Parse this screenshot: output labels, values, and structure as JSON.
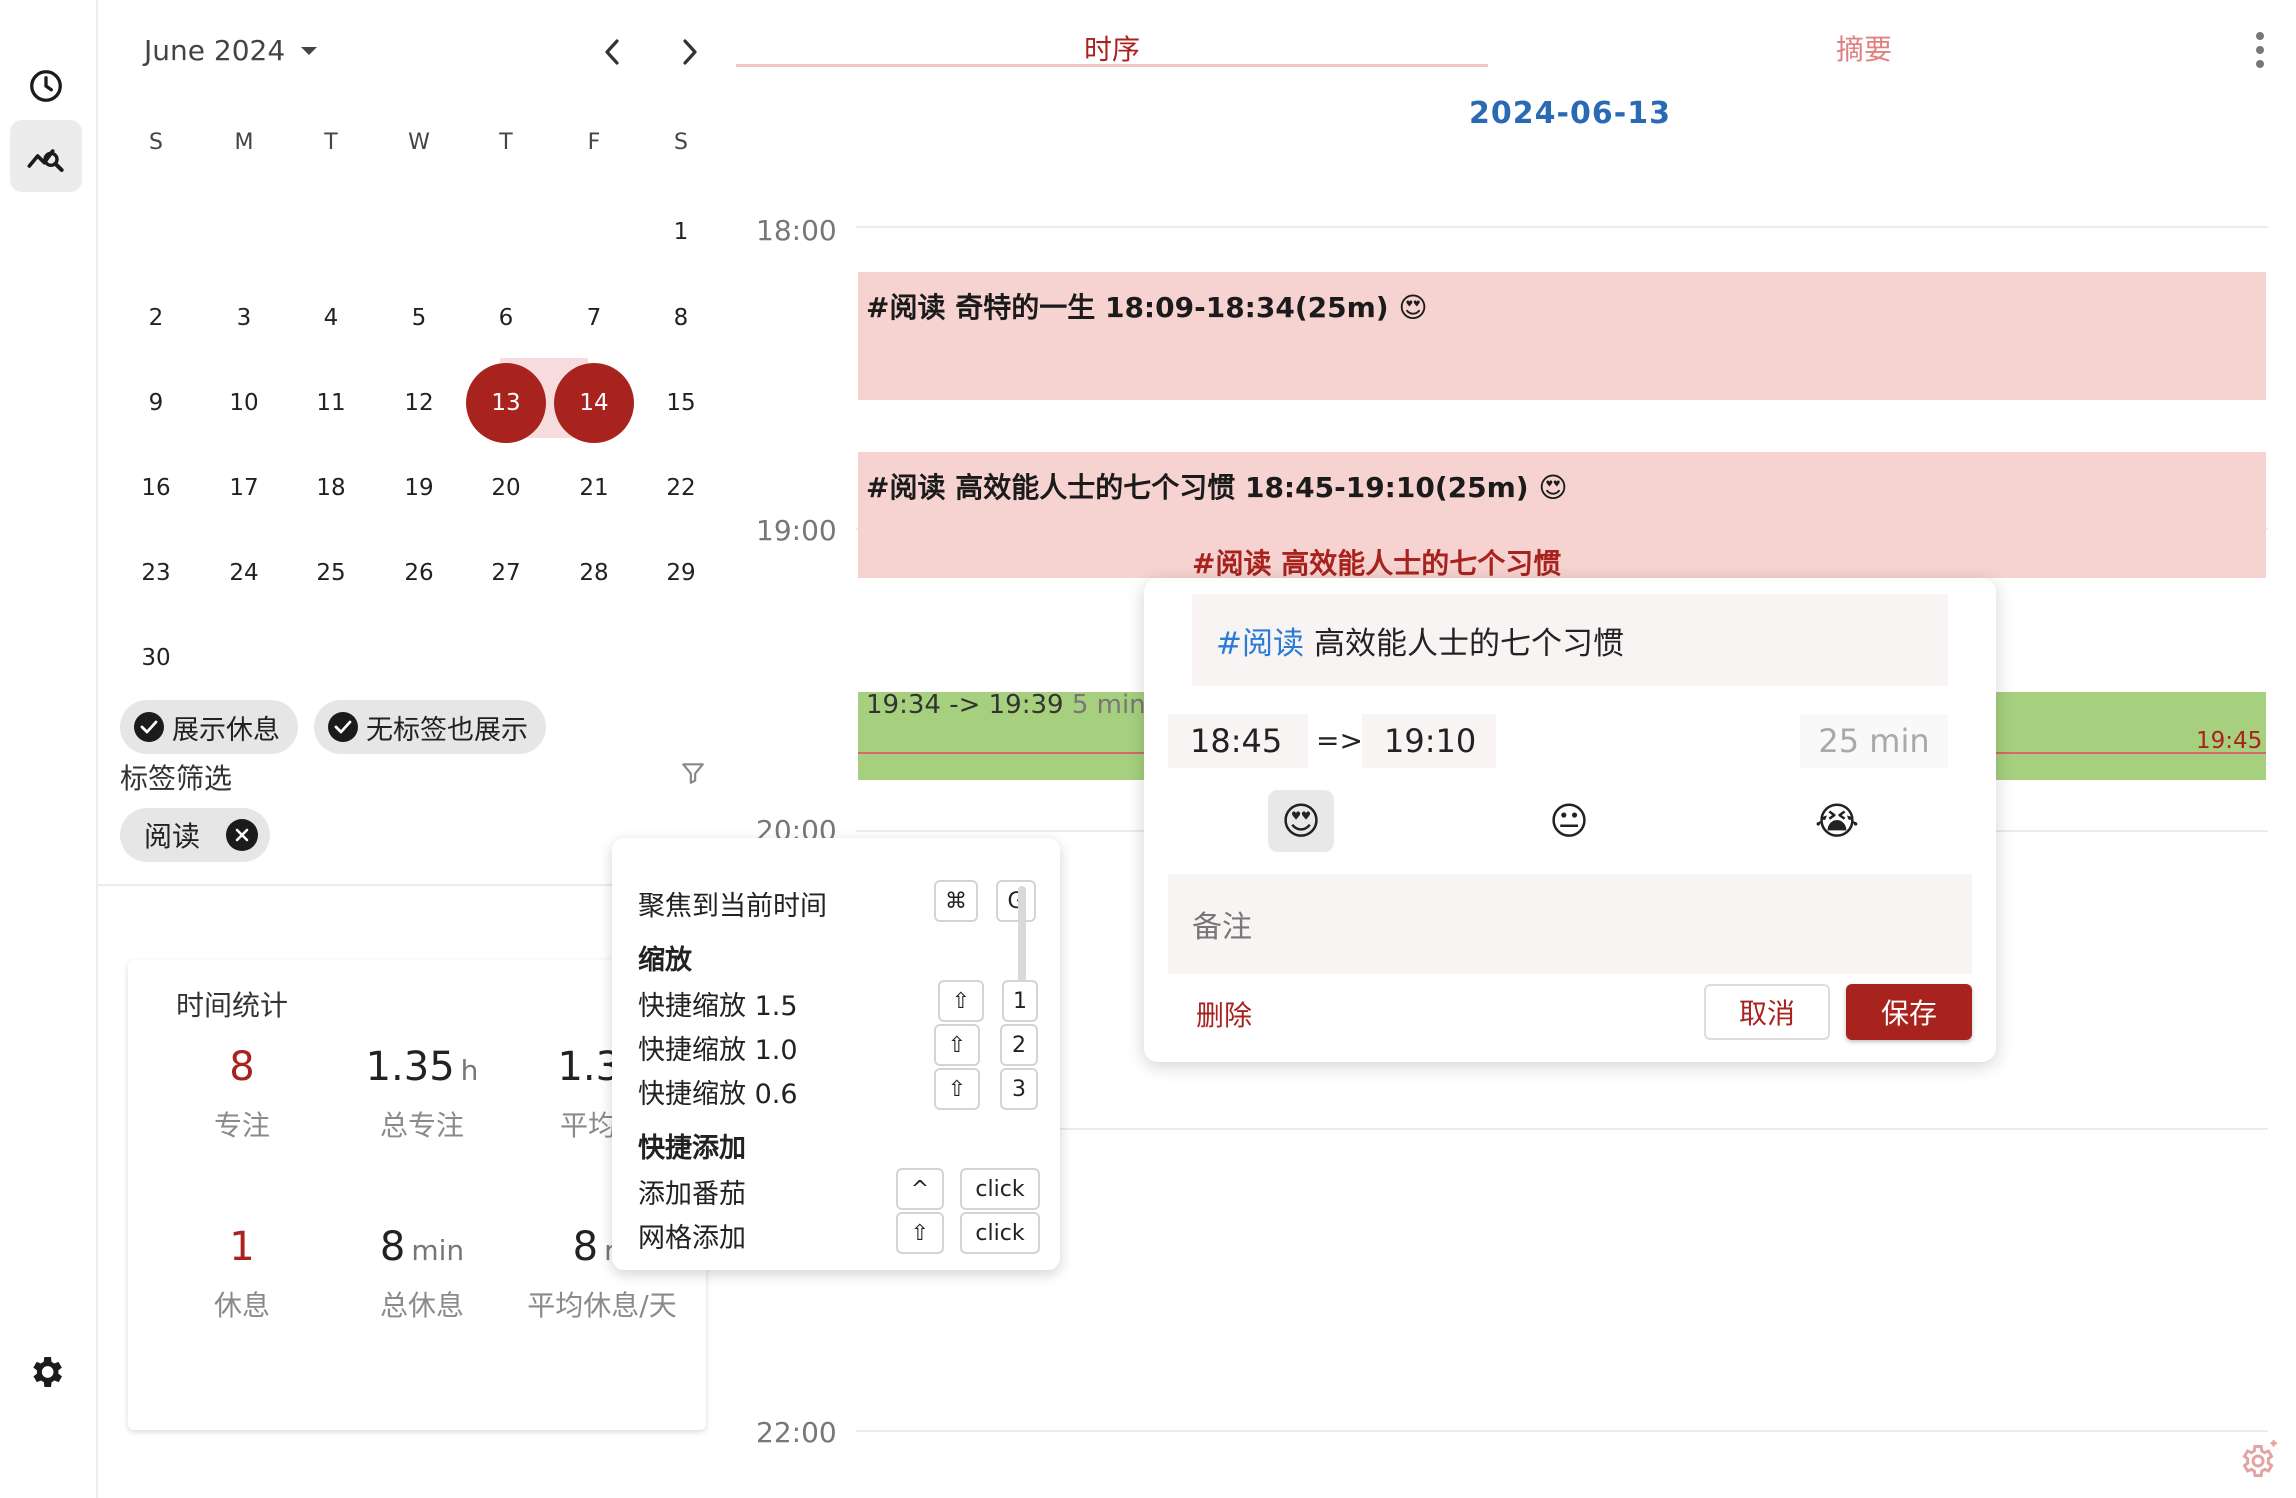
{
  "rail": {
    "icons": [
      "clock-icon",
      "chart-search-icon",
      "gear-icon"
    ]
  },
  "calendar": {
    "month_label": "June 2024",
    "weekdays": [
      "S",
      "M",
      "T",
      "W",
      "T",
      "F",
      "S"
    ],
    "days": [
      "1",
      "2",
      "3",
      "4",
      "5",
      "6",
      "7",
      "8",
      "9",
      "10",
      "11",
      "12",
      "13",
      "14",
      "15",
      "16",
      "17",
      "18",
      "19",
      "20",
      "21",
      "22",
      "23",
      "24",
      "25",
      "26",
      "27",
      "28",
      "29",
      "30"
    ],
    "selected": [
      "13",
      "14"
    ]
  },
  "filters": {
    "show_rest": "展示休息",
    "show_untagged": "无标签也展示",
    "tag_filter_label": "标签筛选",
    "tag_chip": "阅读"
  },
  "stats": {
    "title": "时间统计",
    "items": [
      {
        "value": "8",
        "unit": "",
        "label": "专注"
      },
      {
        "value": "1.35",
        "unit": "h",
        "label": "总专注"
      },
      {
        "value": "1.35",
        "unit": "",
        "label": "平均专"
      },
      {
        "value": "1",
        "unit": "",
        "label": "休息"
      },
      {
        "value": "8",
        "unit": "min",
        "label": "总休息"
      },
      {
        "value": "8",
        "unit": "m",
        "label": "平均休息/天"
      }
    ]
  },
  "shortcuts": {
    "rows": [
      {
        "label": "聚焦到当前时间",
        "keys": [
          "⌘",
          "G"
        ]
      },
      {
        "label": "缩放",
        "heading": true
      },
      {
        "label": "快捷缩放 1.5",
        "keys": [
          "⇧",
          "1"
        ]
      },
      {
        "label": "快捷缩放 1.0",
        "keys": [
          "⇧",
          "2"
        ]
      },
      {
        "label": "快捷缩放 0.6",
        "keys": [
          "⇧",
          "3"
        ]
      },
      {
        "label": "快捷添加",
        "heading": true
      },
      {
        "label": "添加番茄",
        "keys": [
          "^",
          "click"
        ]
      },
      {
        "label": "网格添加",
        "keys": [
          "⇧",
          "click"
        ]
      }
    ]
  },
  "tabs": {
    "timeline": "时序",
    "summary": "摘要"
  },
  "timeline": {
    "date": "2024-06-13",
    "hours": [
      "18:00",
      "19:00",
      "20:00",
      "22:00"
    ],
    "events": [
      {
        "text": "#阅读 奇特的一生 18:09-18:34(25m) 😍"
      },
      {
        "text": "#阅读 高效能人士的七个习惯 18:45-19:10(25m) 😍"
      }
    ],
    "rest_event": {
      "text": "19:34 -> 19:39",
      "duration": "5 min",
      "end_label": "19:45"
    },
    "floating_title": "#阅读 高效能人士的七个习惯"
  },
  "editor": {
    "tag": "#阅读",
    "title": "高效能人士的七个习惯",
    "start": "18:45",
    "arrow": "=>",
    "end": "19:10",
    "duration": "25 min",
    "moods": [
      "😍",
      "😐",
      "😭"
    ],
    "note_placeholder": "备注",
    "delete_label": "删除",
    "cancel_label": "取消",
    "save_label": "保存"
  },
  "colors": {
    "accent": "#a8231e",
    "event_bg": "#f6d3d0",
    "rest_bg": "#a6d07e",
    "date_blue": "#2a6ab5"
  }
}
